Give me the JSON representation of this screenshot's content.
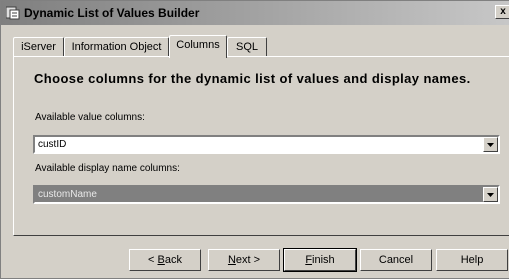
{
  "window": {
    "title": "Dynamic List of Values Builder",
    "close_label": "x"
  },
  "tabs": [
    {
      "label": "iServer",
      "active": false
    },
    {
      "label": "Information Object",
      "active": false
    },
    {
      "label": "Columns",
      "active": true
    },
    {
      "label": "SQL",
      "active": false
    }
  ],
  "panel": {
    "heading": "Choose columns for the dynamic list of values and display names.",
    "value_columns_label": "Available value columns:",
    "value_columns_selected": "custID",
    "display_columns_label": "Available display name columns:",
    "display_columns_selected": "customName"
  },
  "buttons": {
    "back_pre": "< ",
    "back_key": "B",
    "back_post": "ack",
    "next_key": "N",
    "next_post": "ext >",
    "finish_key": "F",
    "finish_post": "inish",
    "cancel": "Cancel",
    "help": "Help"
  },
  "colors": {
    "dialog_bg": "#d4d0c8",
    "titlebar": "#8a8a8a",
    "disabled_combo": "#808080"
  }
}
